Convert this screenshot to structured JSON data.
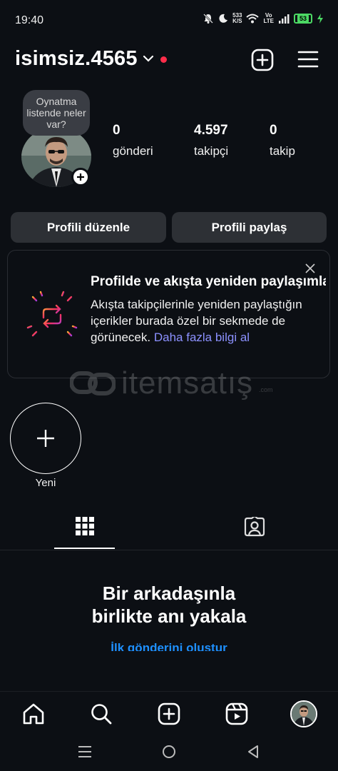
{
  "status_bar": {
    "time": "19:40",
    "speed_value": "533",
    "speed_unit": "K/S",
    "volte_top": "Vo",
    "volte_bottom": "LTE",
    "battery": "53"
  },
  "header": {
    "username": "isimsiz.4565"
  },
  "profile": {
    "note": "Oynatma listende neler var?",
    "stats": [
      {
        "value": "0",
        "label": "gönderi"
      },
      {
        "value": "4.597",
        "label": "takipçi"
      },
      {
        "value": "0",
        "label": "takip"
      }
    ],
    "edit_label": "Profili düzenle",
    "share_label": "Profili paylaş"
  },
  "repost_card": {
    "title": "Profilde ve akışta yeniden paylaşımlar",
    "body": "Akışta takipçilerinle yeniden paylaştığın içerikler burada özel bir sekmede de görünecek.",
    "link": "Daha fazla bilgi al"
  },
  "watermark": {
    "text": "itemsatış",
    "domain": ".com"
  },
  "highlights": {
    "new_label": "Yeni"
  },
  "empty_state": {
    "title_line1": "Bir arkadaşınla",
    "title_line2": "birlikte anı yakala",
    "link": "İlk gönderini oluştur"
  },
  "icons": {
    "bell_off": "bell-off-icon",
    "moon": "moon-icon",
    "wifi": "wifi-icon",
    "signal": "signal-icon",
    "battery": "battery-icon",
    "charging": "charging-icon",
    "new_post": "plus-square-icon",
    "menu": "hamburger-icon",
    "grid": "grid-icon",
    "tagged": "tagged-icon",
    "home": "home-icon",
    "search": "search-icon",
    "create": "create-icon",
    "reels": "reels-icon"
  },
  "colors": {
    "background": "#0c0f14",
    "button": "#2d3035",
    "link": "#8c91ff",
    "primary_link": "#1e90ff",
    "notification_dot": "#ff2d4a"
  }
}
